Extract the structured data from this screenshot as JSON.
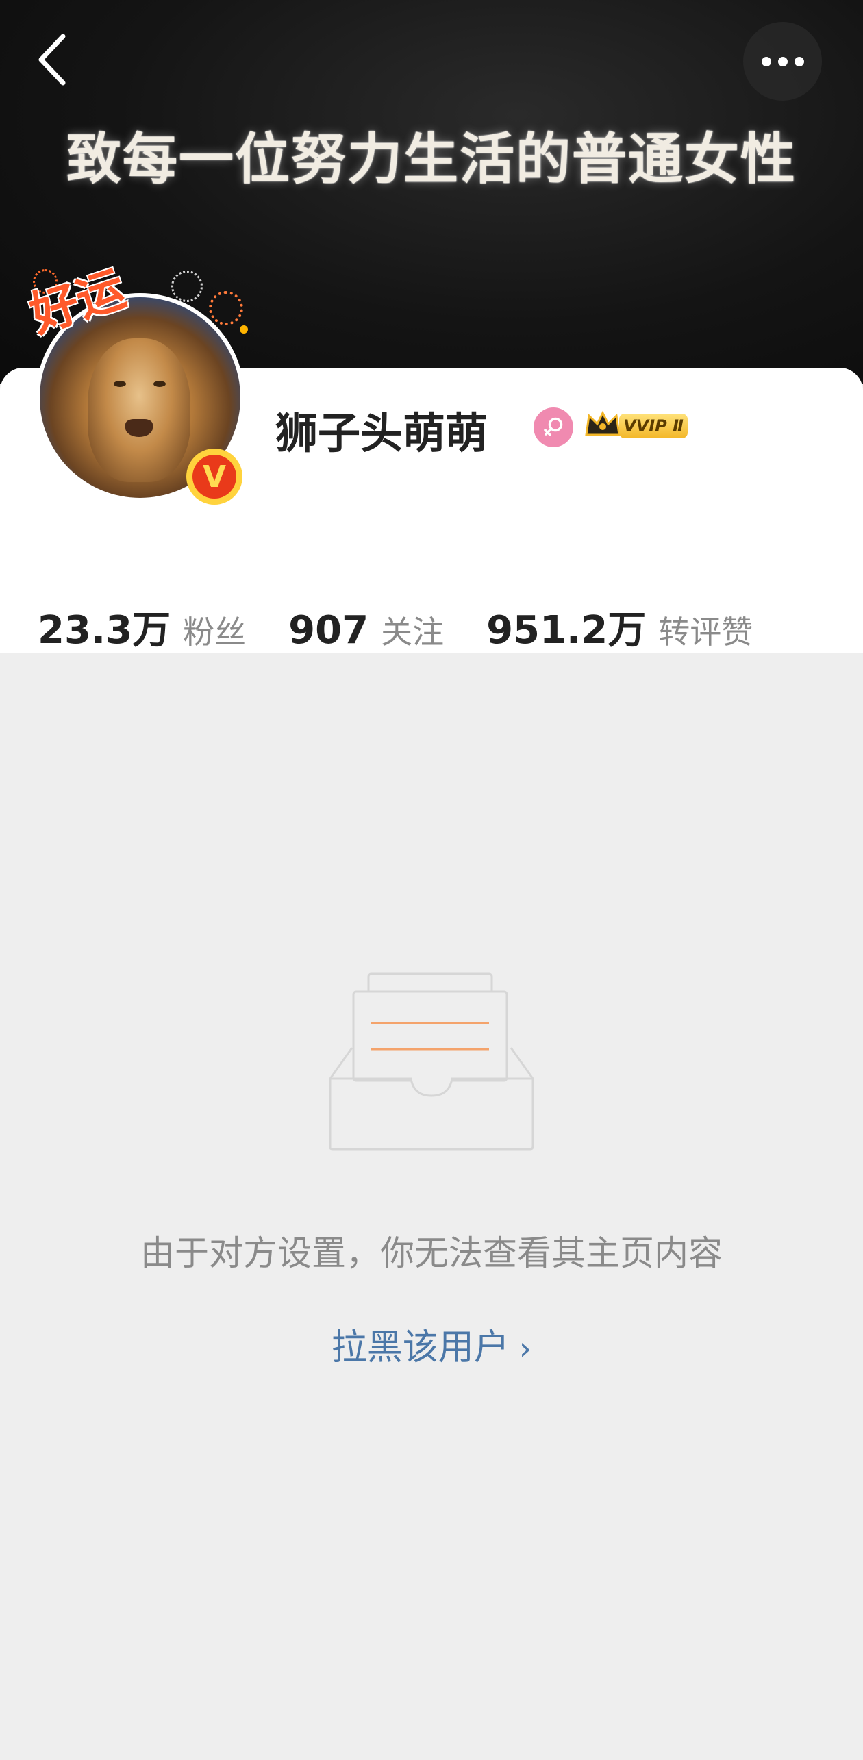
{
  "banner": {
    "text": "致每一位努力生活的普通女性"
  },
  "header": {
    "back_icon": "chevron-left-icon",
    "more_icon": "more-horizontal-icon"
  },
  "profile": {
    "username": "狮子头萌萌",
    "avatar_badge_text": "好运",
    "verified_badge_text": "V",
    "gender_icon": "female-icon",
    "vip_label": "VVIP Ⅱ"
  },
  "stats": [
    {
      "value": "23.3万",
      "label": "粉丝"
    },
    {
      "value": "907",
      "label": "关注"
    },
    {
      "value": "951.2万",
      "label": "转评赞"
    }
  ],
  "empty_state": {
    "icon": "empty-inbox-icon",
    "message": "由于对方设置，你无法查看其主页内容",
    "action_label": "拉黑该用户",
    "action_icon": "chevron-right-icon"
  },
  "colors": {
    "link": "#4b77a8",
    "page_bg": "#eeeeee",
    "accent_orange": "#f4a36b"
  }
}
